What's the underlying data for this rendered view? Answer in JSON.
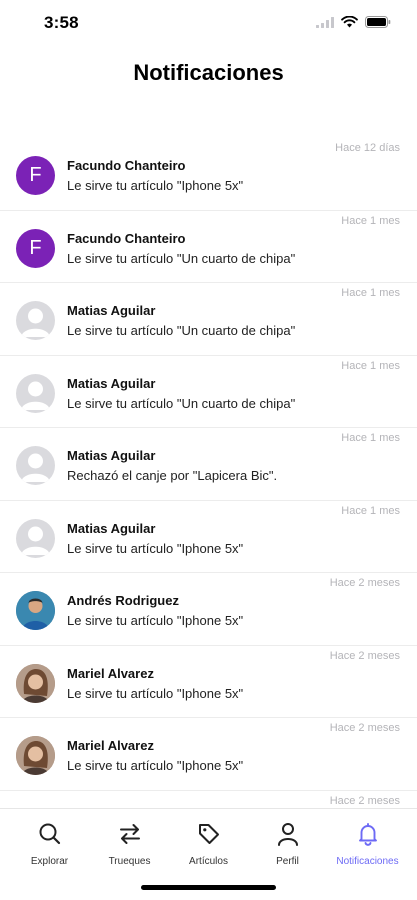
{
  "status_bar": {
    "time": "3:58"
  },
  "header": {
    "title": "Notificaciones"
  },
  "colors": {
    "accent": "#6d6af5",
    "avatar_letter_bg": "#7b22b6",
    "muted_text": "#b4b4b8"
  },
  "notifications": [
    {
      "time": "Hace 12 días",
      "avatar_letter": "F",
      "name": "Facundo Chanteiro",
      "message": "Le sirve tu artículo \"Iphone 5x\""
    },
    {
      "time": "Hace 1 mes",
      "avatar_letter": "F",
      "name": "Facundo Chanteiro",
      "message": "Le sirve tu artículo \"Un cuarto de chipa\""
    },
    {
      "time": "Hace 1 mes",
      "name": "Matias Aguilar",
      "message": "Le sirve tu artículo \"Un cuarto de chipa\""
    },
    {
      "time": "Hace 1 mes",
      "name": "Matias Aguilar",
      "message": "Le sirve tu artículo \"Un cuarto de chipa\""
    },
    {
      "time": "Hace 1 mes",
      "name": "Matias Aguilar",
      "message": "Rechazó el canje por \"Lapicera Bic\"."
    },
    {
      "time": "Hace 1 mes",
      "name": "Matias Aguilar",
      "message": "Le sirve tu artículo \"Iphone 5x\""
    },
    {
      "time": "Hace 2 meses",
      "name": "Andrés Rodriguez",
      "message": "Le sirve tu artículo \"Iphone 5x\""
    },
    {
      "time": "Hace 2 meses",
      "name": "Mariel Alvarez",
      "message": "Le sirve tu artículo \"Iphone 5x\""
    },
    {
      "time": "Hace 2 meses",
      "name": "Mariel Alvarez",
      "message": "Le sirve tu artículo \"Iphone 5x\""
    },
    {
      "time": "Hace 2 meses",
      "name": "",
      "message": ""
    }
  ],
  "tabs": [
    {
      "label": "Explorar",
      "icon": "search-icon"
    },
    {
      "label": "Trueques",
      "icon": "swap-arrows-icon"
    },
    {
      "label": "Artículos",
      "icon": "tag-icon"
    },
    {
      "label": "Perfil",
      "icon": "person-icon"
    },
    {
      "label": "Notificaciones",
      "icon": "bell-icon",
      "active": true
    }
  ]
}
